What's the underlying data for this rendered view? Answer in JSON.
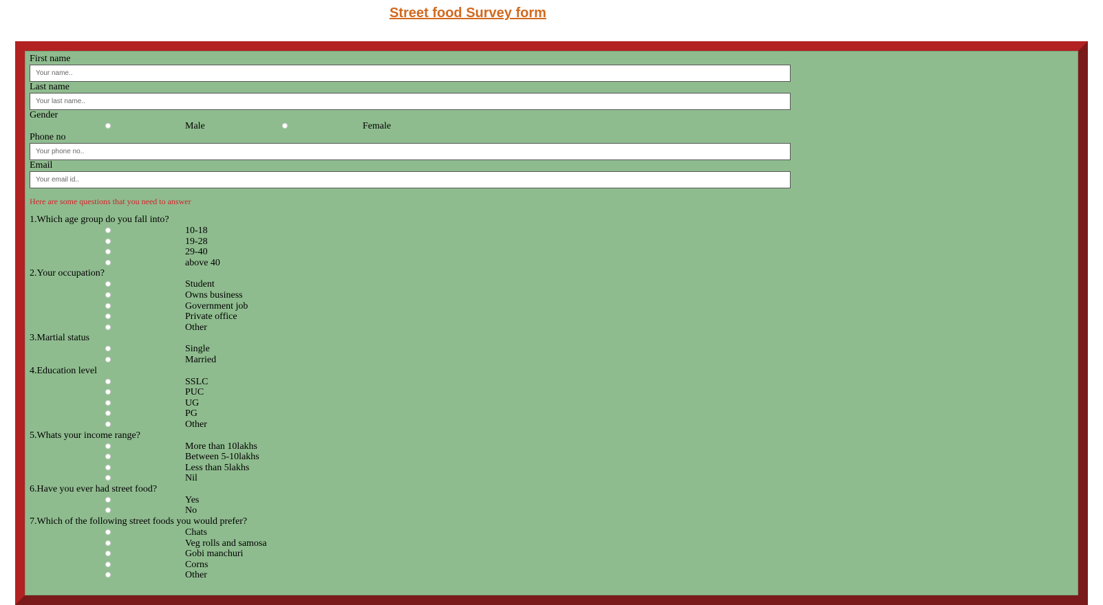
{
  "title": "Street food Survey form",
  "colors": {
    "title": "#d2691e",
    "frame_border": "#b22222",
    "frame_bg": "#8fbc8f",
    "note": "#d2232a"
  },
  "fields": {
    "first_name": {
      "label": "First name",
      "placeholder": "Your name.."
    },
    "last_name": {
      "label": "Last name",
      "placeholder": "Your last name.."
    },
    "gender": {
      "label": "Gender",
      "options": [
        "Male",
        "Female"
      ]
    },
    "phone": {
      "label": "Phone no",
      "placeholder": "Your phone no.."
    },
    "email": {
      "label": "Email",
      "placeholder": "Your email id.."
    }
  },
  "note": "Here are some questions that you need to answer",
  "questions": [
    {
      "q": "1.Which age group do you fall into?",
      "options": [
        "10-18",
        "19-28",
        "29-40",
        "above 40"
      ]
    },
    {
      "q": "2.Your occupation?",
      "options": [
        "Student",
        "Owns business",
        "Government job",
        "Private office",
        "Other"
      ]
    },
    {
      "q": "3.Martial status",
      "options": [
        "Single",
        "Married"
      ]
    },
    {
      "q": "4.Education level",
      "options": [
        "SSLC",
        "PUC",
        "UG",
        "PG",
        "Other"
      ]
    },
    {
      "q": "5.Whats your income range?",
      "options": [
        "More than 10lakhs",
        "Between 5-10lakhs",
        "Less than 5lakhs",
        "Nil"
      ]
    },
    {
      "q": "6.Have you ever had street food?",
      "options": [
        "Yes",
        "No"
      ]
    },
    {
      "q": "7.Which of the following street foods you would prefer?",
      "options": [
        "Chats",
        "Veg rolls and samosa",
        "Gobi manchuri",
        "Corns",
        "Other"
      ]
    }
  ]
}
